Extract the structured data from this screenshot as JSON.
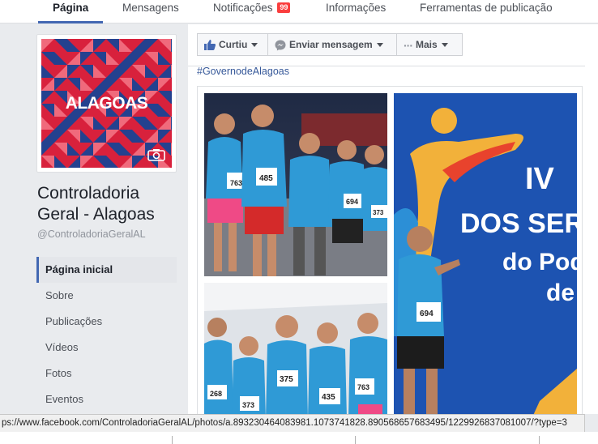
{
  "tabs": [
    {
      "label": "Página"
    },
    {
      "label": "Mensagens"
    },
    {
      "label": "Notificações",
      "badge": "99"
    },
    {
      "label": "Informações"
    },
    {
      "label": "Ferramentas de publicação"
    }
  ],
  "profile": {
    "logo_text": "ALAGOAS",
    "name": "Controladoria Geral - Alagoas",
    "handle": "@ControladoriaGeralAL"
  },
  "nav": [
    {
      "label": "Página inicial"
    },
    {
      "label": "Sobre"
    },
    {
      "label": "Publicações"
    },
    {
      "label": "Vídeos"
    },
    {
      "label": "Fotos"
    },
    {
      "label": "Eventos"
    }
  ],
  "actions": {
    "like": "Curtiu",
    "message": "Enviar mensagem",
    "more": "Mais"
  },
  "post": {
    "hashtag": "#GovernodeAlagoas",
    "photo1_bibs": [
      "763",
      "485",
      "694",
      "373"
    ],
    "photo2_bibs": [
      "268",
      "373",
      "375",
      "435",
      "763"
    ],
    "photo3_banner": [
      "IV",
      "DOS SERV",
      "do Pod",
      "de"
    ],
    "photo3_bib": "694"
  },
  "status_url": "ps://www.facebook.com/ControladoriaGeralAL/photos/a.893230464083981.1073741828.890568657683495/1229926837081007/?type=3",
  "colors": {
    "brand_blue": "#4267b2",
    "link_blue": "#365899",
    "badge_red": "#fa3e3e",
    "alagoas_red": "#d8213c",
    "alagoas_blue": "#24418f"
  }
}
